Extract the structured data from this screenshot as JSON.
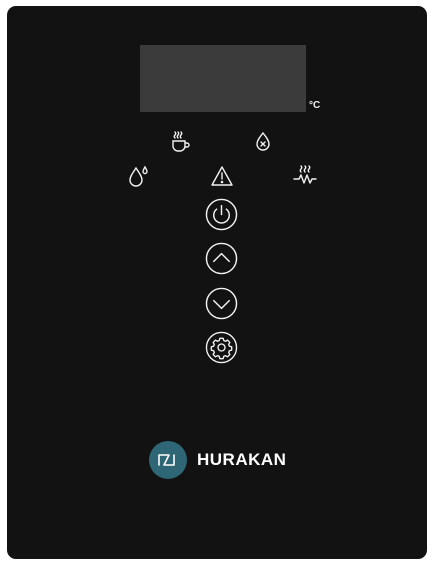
{
  "display": {
    "unit": "°C"
  },
  "indicators": [
    {
      "icon": "hot-cup-icon"
    },
    {
      "icon": "no-water-icon"
    },
    {
      "icon": "water-drop-icon"
    },
    {
      "icon": "warning-icon"
    },
    {
      "icon": "heating-element-icon"
    }
  ],
  "controls": [
    {
      "icon": "power-icon"
    },
    {
      "icon": "chevron-up-icon"
    },
    {
      "icon": "chevron-down-icon"
    },
    {
      "icon": "gear-icon"
    }
  ],
  "brand": {
    "name": "HURAKAN",
    "logo_color": "#2e6675"
  },
  "colors": {
    "panel": "#121212",
    "display": "#3b3b3b",
    "icon": "#f2f2f2"
  }
}
